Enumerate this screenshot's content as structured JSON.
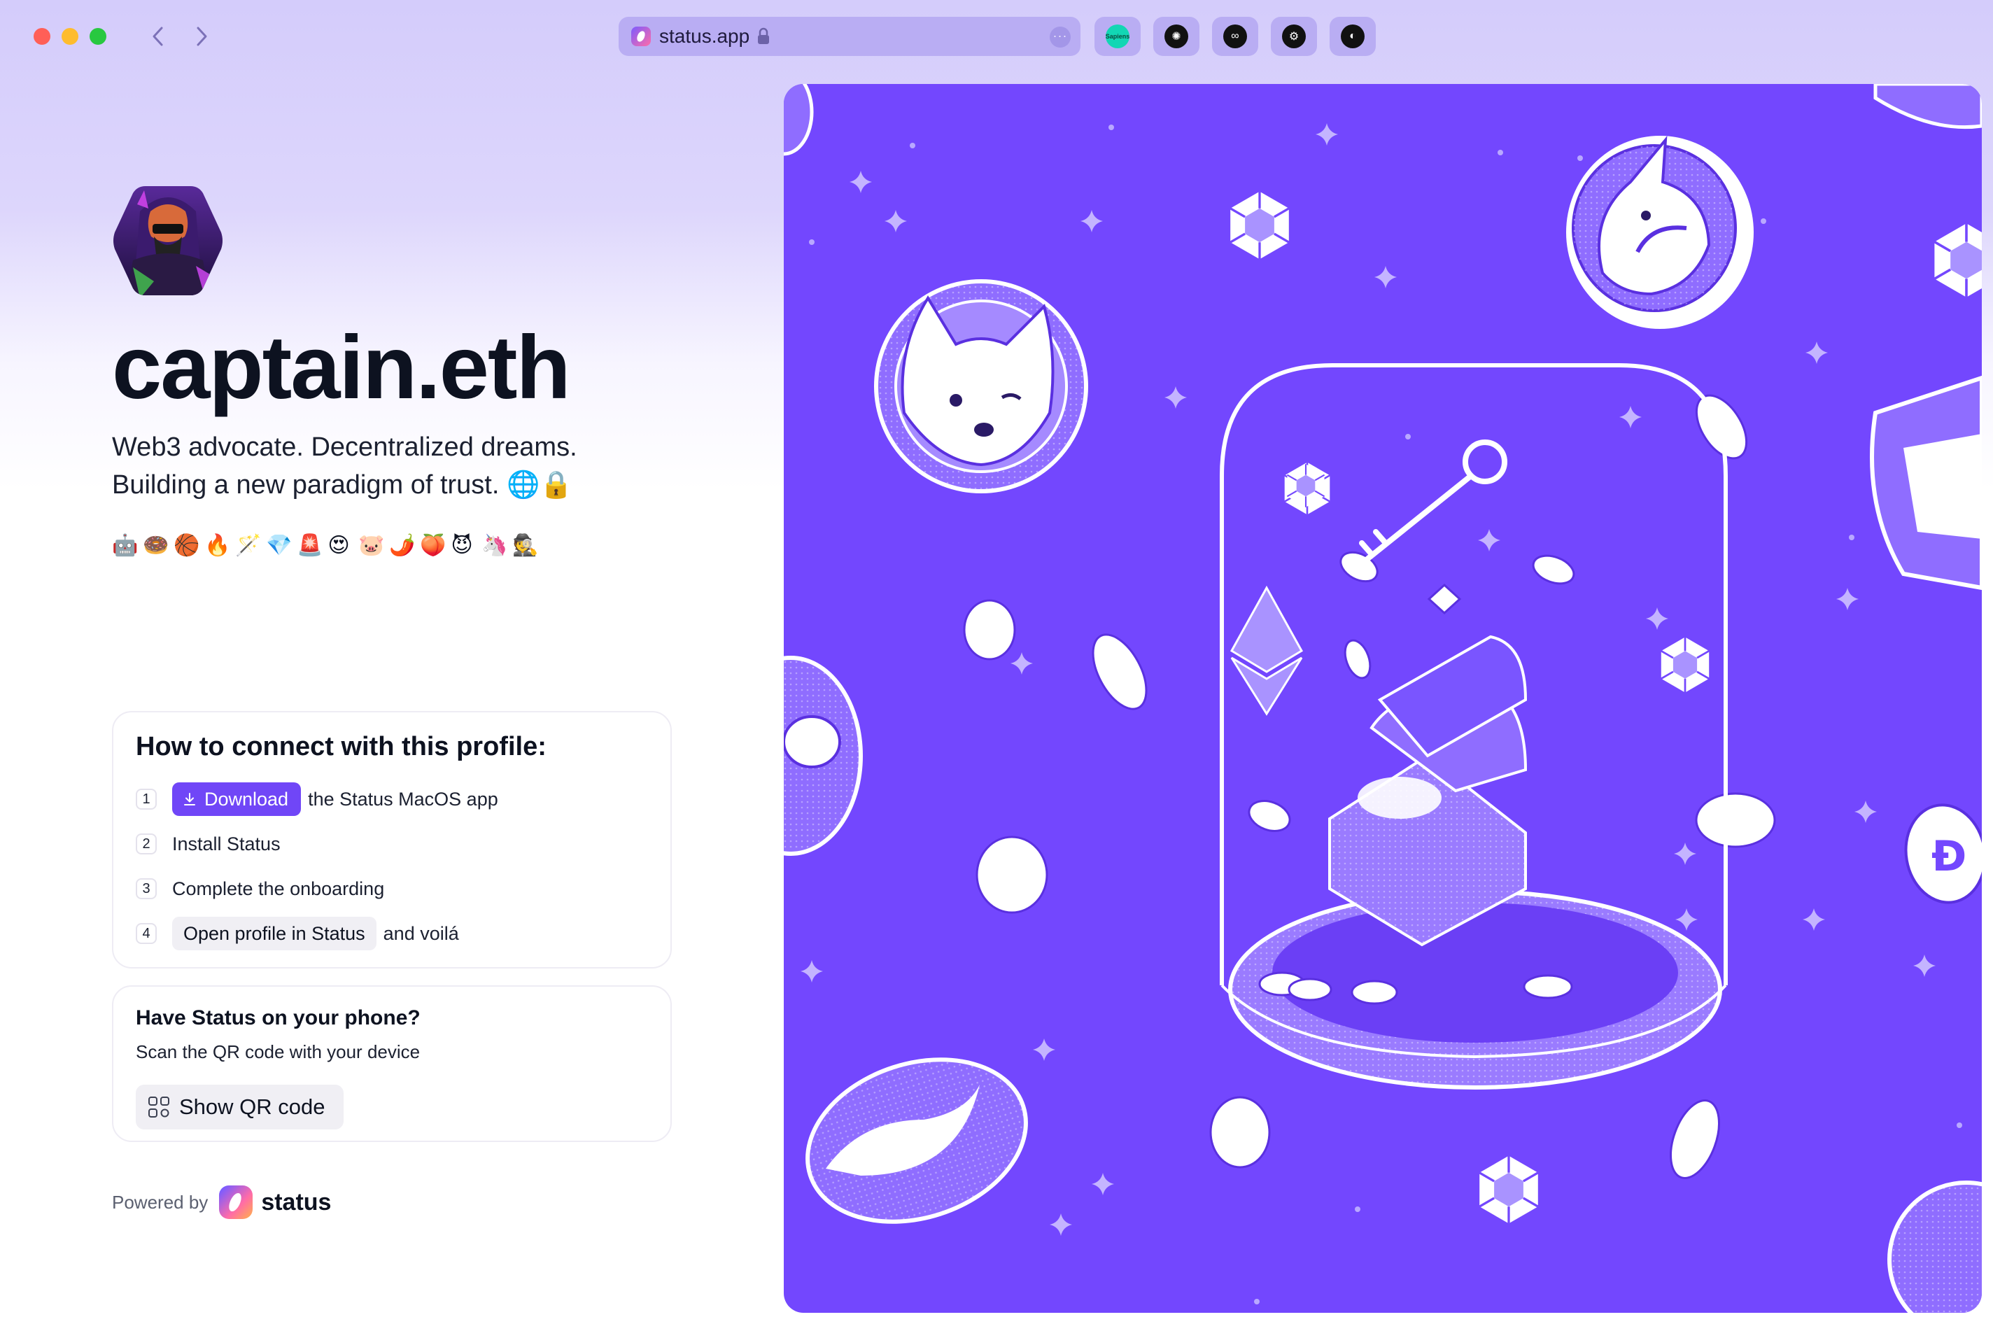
{
  "browser": {
    "url": "status.app",
    "extensions": [
      "rainbow-extension-icon",
      "network-extension-icon",
      "link-extension-icon",
      "gear-extension-icon",
      "shield-extension-icon"
    ],
    "ext1_label": "Sapiens"
  },
  "profile": {
    "display_name": "captain.eth",
    "bio_line1": "Web3 advocate. Decentralized dreams.",
    "bio_line2": "Building a new paradigm of trust. 🌐🔒",
    "emojis": [
      "🤖",
      "🍩",
      "🏀",
      "🔥",
      "🪄",
      "💎",
      "🚨",
      "😍",
      "🐷",
      "🌶️",
      "🍑",
      "😈",
      "🦄",
      "🕵️"
    ]
  },
  "connect": {
    "title": "How to connect with this profile:",
    "steps": [
      {
        "num": "1",
        "button": "Download",
        "text": "the Status MacOS app"
      },
      {
        "num": "2",
        "text": "Install Status"
      },
      {
        "num": "3",
        "text": "Complete the onboarding"
      },
      {
        "num": "4",
        "button": "Open profile in Status",
        "text": "and voilá"
      }
    ]
  },
  "phone": {
    "title": "Have Status on your phone?",
    "subtitle": "Scan the QR code with your device",
    "button": "Show QR code"
  },
  "footer": {
    "powered_by": "Powered by",
    "brand": "status"
  },
  "colors": {
    "accent": "#7046f7",
    "hero_bg": "#7347fe"
  }
}
